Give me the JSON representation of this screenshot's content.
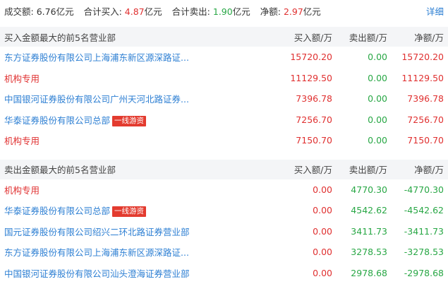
{
  "summary": {
    "turnover_label": "成交额:",
    "turnover_value": "6.76",
    "turnover_unit": "亿元",
    "buy_label": "合计买入:",
    "buy_value": "4.87",
    "buy_unit": "亿元",
    "sell_label": "合计卖出:",
    "sell_value": "1.90",
    "sell_unit": "亿元",
    "net_label": "净额:",
    "net_value": "2.97",
    "net_unit": "亿元",
    "detail_link": "详细"
  },
  "buy_section": {
    "header": {
      "title": "买入金额最大的前5名营业部",
      "col_buy": "买入额/万",
      "col_sell": "卖出额/万",
      "col_net": "净额/万"
    },
    "rows": [
      {
        "name": "东方证券股份有限公司上海浦东新区源深路证...",
        "name_color": "blue",
        "badge": "",
        "buy": "15720.20",
        "sell": "0.00",
        "net": "15720.20"
      },
      {
        "name": "机构专用",
        "name_color": "red",
        "badge": "",
        "buy": "11129.50",
        "sell": "0.00",
        "net": "11129.50"
      },
      {
        "name": "中国银河证券股份有限公司广州天河北路证券...",
        "name_color": "blue",
        "badge": "",
        "buy": "7396.78",
        "sell": "0.00",
        "net": "7396.78"
      },
      {
        "name": "华泰证券股份有限公司总部",
        "name_color": "blue",
        "badge": "一线游资",
        "buy": "7256.70",
        "sell": "0.00",
        "net": "7256.70"
      },
      {
        "name": "机构专用",
        "name_color": "red",
        "badge": "",
        "buy": "7150.70",
        "sell": "0.00",
        "net": "7150.70"
      }
    ]
  },
  "sell_section": {
    "header": {
      "title": "卖出金额最大的前5名营业部",
      "col_buy": "买入额/万",
      "col_sell": "卖出额/万",
      "col_net": "净额/万"
    },
    "rows": [
      {
        "name": "机构专用",
        "name_color": "red",
        "badge": "",
        "buy": "0.00",
        "sell": "4770.30",
        "net": "-4770.30"
      },
      {
        "name": "华泰证券股份有限公司总部",
        "name_color": "blue",
        "badge": "一线游资",
        "buy": "0.00",
        "sell": "4542.62",
        "net": "-4542.62"
      },
      {
        "name": "国元证券股份有限公司绍兴二环北路证券营业部",
        "name_color": "blue",
        "badge": "",
        "buy": "0.00",
        "sell": "3411.73",
        "net": "-3411.73"
      },
      {
        "name": "东方证券股份有限公司上海浦东新区源深路证...",
        "name_color": "blue",
        "badge": "",
        "buy": "0.00",
        "sell": "3278.53",
        "net": "-3278.53"
      },
      {
        "name": "中国银河证券股份有限公司汕头澄海证券营业部",
        "name_color": "blue",
        "badge": "",
        "buy": "0.00",
        "sell": "2978.68",
        "net": "-2978.68"
      }
    ]
  },
  "colors": {
    "red": "#e03030",
    "green": "#28a745",
    "blue": "#2d7fd3",
    "badge_bg": "#e33b2f",
    "header_bg": "#f4f5f7"
  }
}
